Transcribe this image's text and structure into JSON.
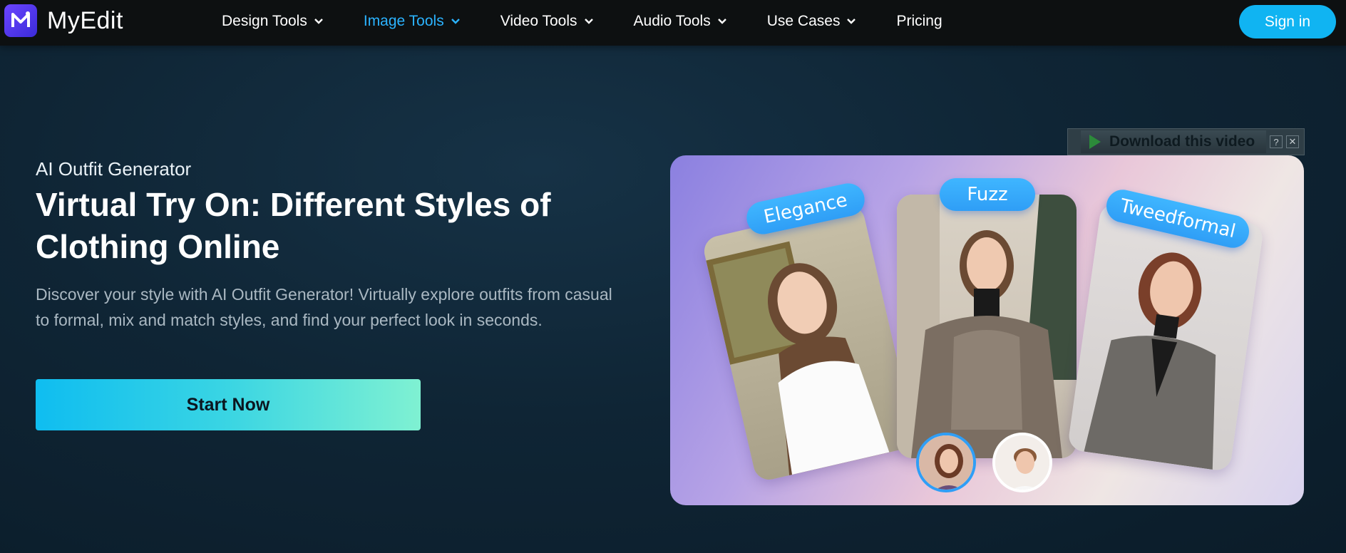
{
  "nav": {
    "brand": "MyEdit",
    "items": [
      {
        "label": "Design Tools",
        "dropdown": true,
        "active": false
      },
      {
        "label": "Image Tools",
        "dropdown": true,
        "active": true
      },
      {
        "label": "Video Tools",
        "dropdown": true,
        "active": false
      },
      {
        "label": "Audio Tools",
        "dropdown": true,
        "active": false
      },
      {
        "label": "Use Cases",
        "dropdown": true,
        "active": false
      },
      {
        "label": "Pricing",
        "dropdown": false,
        "active": false
      }
    ],
    "signin_label": "Sign in"
  },
  "hero": {
    "kicker": "AI Outfit Generator",
    "headline": "Virtual Try On: Different Styles of Clothing Online",
    "description": "Discover your style with AI Outfit Generator! Virtually explore outfits from casual to formal, mix and match styles, and find your perfect look in seconds.",
    "cta_label": "Start Now",
    "style_tags": [
      "Elegance",
      "Fuzz",
      "Tweedformal"
    ]
  },
  "download_bar": {
    "label": "Download this video",
    "help": "?",
    "close": "✕"
  },
  "colors": {
    "accent": "#10b4f2",
    "nav_active": "#2bb3ff",
    "tag": "#2f9ef6"
  }
}
